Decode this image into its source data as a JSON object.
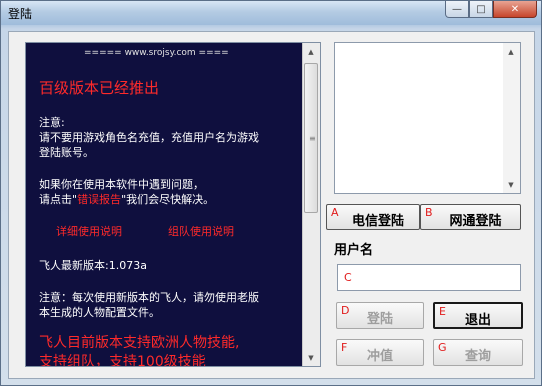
{
  "window": {
    "title": "登陆",
    "controls": {
      "minimize": "—",
      "maximize": "□",
      "close": "✕"
    }
  },
  "notice": {
    "header": "===== www.srojsy.com ====",
    "headline": "百级版本已经推出",
    "note_title": "注意:",
    "note_line1": "请不要用游戏角色名充值，充值用户名为游戏",
    "note_line2": "登陆账号。",
    "problem_line1": "如果你在使用本软件中遇到问题，",
    "problem_line2_a": "请点击\"",
    "problem_link": "错误报告",
    "problem_line2_b": "\"我们会尽快解决。",
    "link_detail": "详细使用说明",
    "link_team": "组队使用说明",
    "version_line": "飞人最新版本:1.073a",
    "notice2_line1": "注意：每次使用新版本的飞人，请勿使用老版",
    "notice2_line2": "本生成的人物配置文件。",
    "bottom_line1": "飞人目前版本支持欧洲人物技能,",
    "bottom_line2": "支持组队，支持100级技能"
  },
  "server_buttons": {
    "telecom": {
      "letter": "A",
      "label": "电信登陆"
    },
    "netcom": {
      "letter": "B",
      "label": "网通登陆"
    }
  },
  "username": {
    "label": "用户名",
    "letter": "C",
    "value": "",
    "placeholder": ""
  },
  "actions": {
    "login": {
      "letter": "D",
      "label": "登陆"
    },
    "exit": {
      "letter": "E",
      "label": "退出"
    },
    "recharge": {
      "letter": "F",
      "label": "冲值"
    },
    "query": {
      "letter": "G",
      "label": "查询"
    }
  },
  "colors": {
    "notice_bg": "#0f0f3e",
    "notice_text": "#ffffff",
    "highlight_red": "#ff2a2a",
    "letter_red": "#e01b1b"
  }
}
